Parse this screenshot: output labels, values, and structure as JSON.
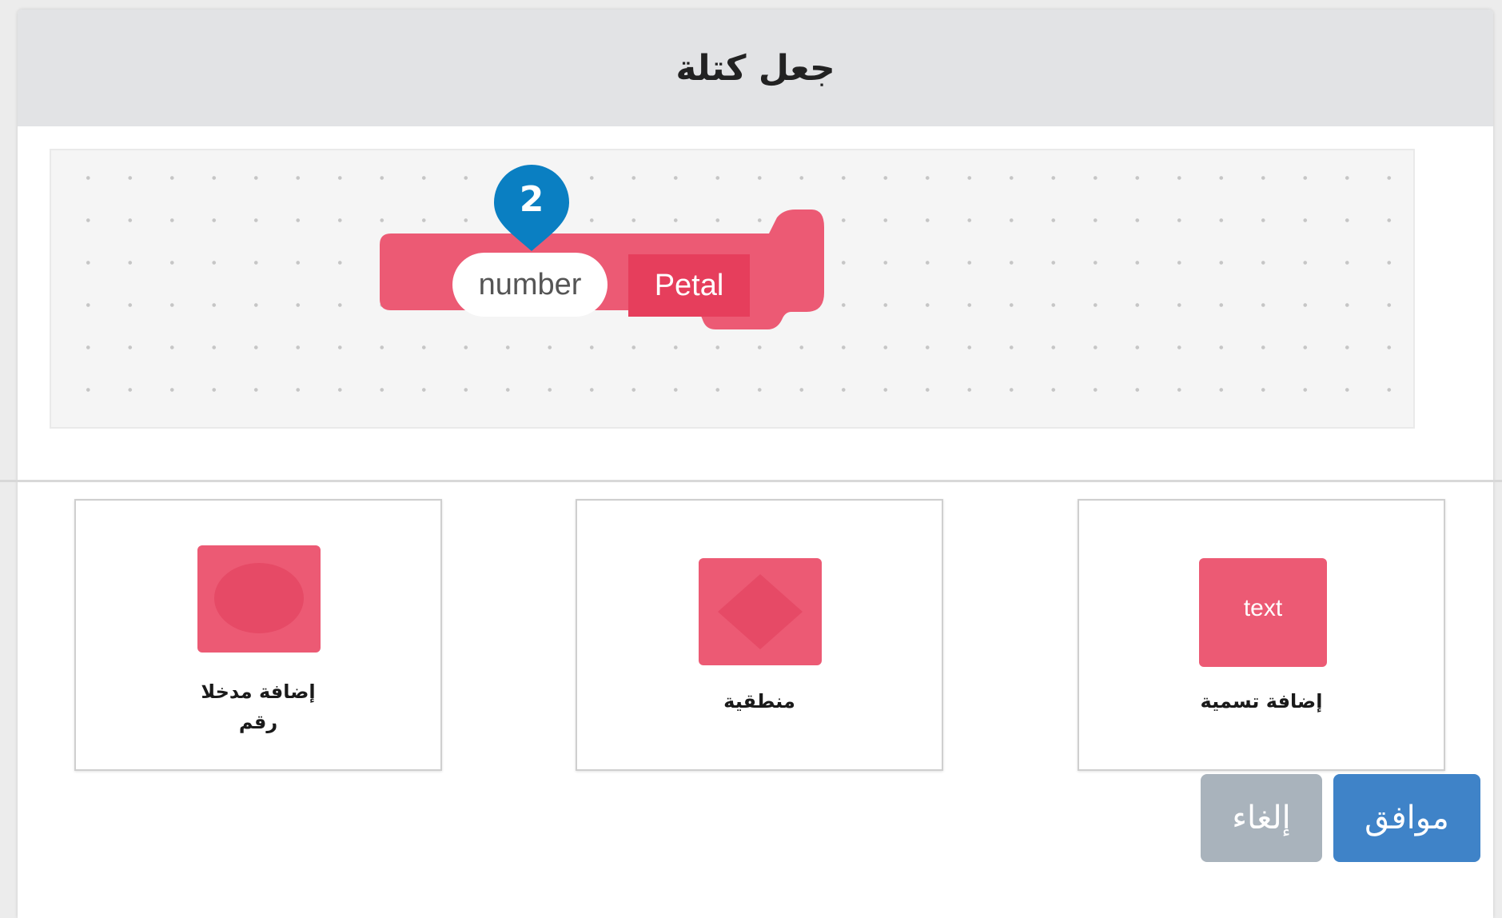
{
  "dialog": {
    "title": "جعل كتلة"
  },
  "block": {
    "argument_placeholder": "number",
    "label_text": "Petal",
    "color": "#ec5a74"
  },
  "callout": {
    "number": "2",
    "color": "#0a7fc2"
  },
  "options": [
    {
      "name": "add-number-input",
      "label_line1": "إضافة مدخلا",
      "label_line2": "رقم",
      "icon": "oval-icon"
    },
    {
      "name": "add-boolean-input",
      "label": "منطقية",
      "icon": "diamond-icon"
    },
    {
      "name": "add-label",
      "label": "إضافة تسمية",
      "icon_text": "text",
      "icon": "text-icon"
    }
  ],
  "buttons": {
    "ok": "موافق",
    "cancel": "إلغاء"
  },
  "colors": {
    "ok": "#3f83c8",
    "cancel": "#a9b3bc",
    "header": "#e2e3e5"
  }
}
